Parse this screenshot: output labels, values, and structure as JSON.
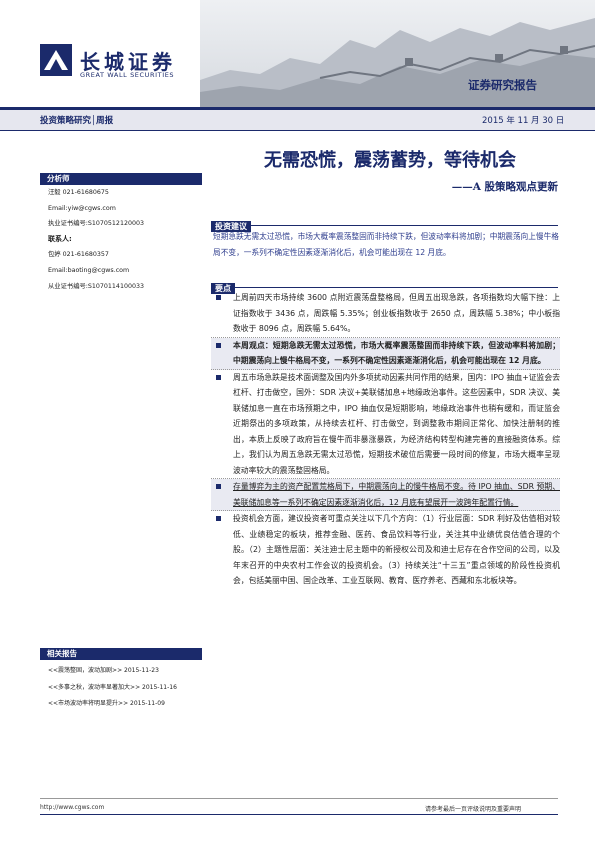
{
  "header": {
    "logo_cn": "长城证券",
    "logo_en": "GREAT WALL SECURITIES",
    "report_type": "证券研究报告",
    "category": "投资策略研究│周报",
    "date": "2015 年 11 月 30 日"
  },
  "title": "无需恐慌，震荡蓄势，等待机会",
  "subtitle": "——A 股策略观点更新",
  "sidebar": {
    "analyst_header": "分析师",
    "analyst_lines": [
      {
        "text": "汪毅 021-61680675",
        "bold": false
      },
      {
        "text": "Email:yiw@cgws.com",
        "bold": false
      },
      {
        "text": "执业证书编号:S1070512120003",
        "bold": false
      },
      {
        "text": "联系人:",
        "bold": true
      },
      {
        "text": "包婷 021-61680357",
        "bold": false
      },
      {
        "text": "Email:baoting@cgws.com",
        "bold": false
      },
      {
        "text": "从业证书编号:S1070114100033",
        "bold": false
      }
    ],
    "related_header": "相关报告",
    "related": [
      "<<震荡整固，波动加剧>> 2015-11-23",
      "<<多事之秋，波动率显著加大>> 2015-11-16",
      "<<市场波动率将明显提升>> 2015-11-09"
    ]
  },
  "sections": {
    "advice_header": "投资建议",
    "advice_text": "短期急跌无需太过恐慌，市场大概率震荡整固而非持续下跌，但波动率料将加剧；中期震荡向上慢牛格局不变，一系列不确定性因素逐渐消化后，机会可能出现在 12 月底。",
    "points_header": "要点",
    "points": [
      {
        "text": "上周前四天市场持续 3600 点附近震荡盘整格局，但周五出现急跌，各项指数均大幅下挫：上证指数收于 3436 点，周跌幅 5.35%；创业板指数收于 2650 点，周跌幅 5.38%；中小板指数收于 8096 点，周跌幅 5.64%。",
        "style": "normal"
      },
      {
        "text": "本周观点：短期急跌无需太过恐慌，市场大概率震荡整固而非持续下跌，但波动率料将加剧；中期震荡向上慢牛格局不变，一系列不确定性因素逐渐消化后，机会可能出现在 12 月底。",
        "style": "bold"
      },
      {
        "text": "周五市场急跌是技术面调整及国内外多项扰动因素共同作用的结果，国内：IPO 抽血+证监会去杠杆、打击做空，国外：SDR 决议+美联储加息+地缘政治事件。这些因素中，SDR 决议、美联储加息一直在市场预期之中，IPO 抽血仅是短期影响，地缘政治事件也稍有缓和，而证监会近期祭出的多项政策，从持续去杠杆、打击做空，到调整救市期间正常化、加快注册制的推出，本质上反映了政府旨在慢牛而非暴涨暴跌，为经济结构转型构建完善的直接融资体系。综上，我们认为周五急跌无需太过恐慌，短期技术破位后需要一段时间的修复，市场大概率呈现波动率较大的震荡整固格局。",
        "style": "normal"
      },
      {
        "text": "存量博弈为主的资产配置荒格局下，中期震荡向上的慢牛格局不变。待 IPO 抽血、SDR 预期、美联储加息等一系列不确定因素逐渐消化后，12 月底有望展开一波跨年配置行情。",
        "style": "underline"
      },
      {
        "text": "投资机会方面，建议投资者可重点关注以下几个方向：（1）行业层面：SDR 利好及估值相对较低、业绩稳定的板块，推荐金融、医药、食品饮料等行业，关注其中业绩优良估值合理的个股。（2）主题性层面：关注迪士尼主题中的新授权公司及和迪士尼存在合作空间的公司，以及年末召开的中央农村工作会议的投资机会。（3）持续关注“十三五”重点领域的阶段性投资机会，包括美丽中国、国企改革、工业互联网、教育、医疗养老、西藏和东北板块等。",
        "style": "normal"
      }
    ]
  },
  "footer": {
    "url": "http://www.cgws.com",
    "note": "请参考最后一页评级说明及重要声明"
  },
  "colors": {
    "brand_navy": "#1b2a6b",
    "advice_text": "#2f3e8e",
    "bar_bg": "#e6e7ef"
  }
}
